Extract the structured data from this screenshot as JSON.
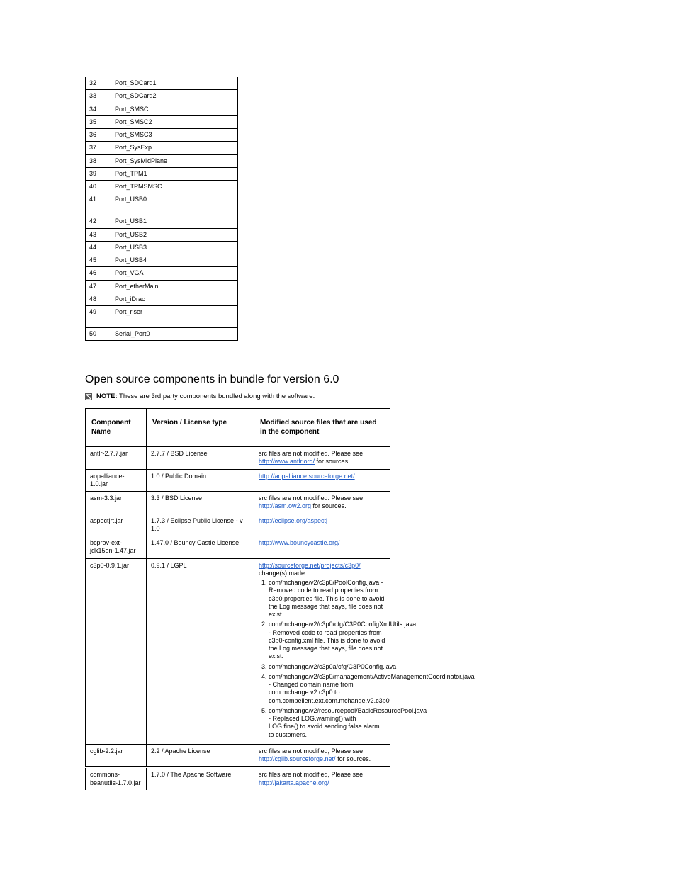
{
  "ports": [
    {
      "n": "32",
      "name": "Port_SDCard1"
    },
    {
      "n": "33",
      "name": "Port_SDCard2"
    },
    {
      "n": "34",
      "name": "Port_SMSC"
    },
    {
      "n": "35",
      "name": "Port_SMSC2"
    },
    {
      "n": "36",
      "name": "Port_SMSC3"
    },
    {
      "n": "37",
      "name": "Port_SysExp"
    },
    {
      "n": "38",
      "name": "Port_SysMidPlane"
    },
    {
      "n": "39",
      "name": "Port_TPM1"
    },
    {
      "n": "40",
      "name": "Port_TPMSMSC"
    },
    {
      "n": "41",
      "name": "Port_USB0"
    },
    {
      "n": "42",
      "name": "Port_USB1"
    },
    {
      "n": "43",
      "name": "Port_USB2"
    },
    {
      "n": "44",
      "name": "Port_USB3"
    },
    {
      "n": "45",
      "name": "Port_USB4"
    },
    {
      "n": "46",
      "name": "Port_VGA"
    },
    {
      "n": "47",
      "name": "Port_etherMain"
    },
    {
      "n": "48",
      "name": "Port_iDrac"
    },
    {
      "n": "49",
      "name": "Port_riser"
    },
    {
      "n": "50",
      "name": "Serial_Port0"
    }
  ],
  "section_heading": "Open source components in bundle for version 6.0",
  "note_label": "NOTE:",
  "note_text": "These are 3rd party components bundled along with the software.",
  "components_headers": {
    "name": "Component Name",
    "version": "Version / License type",
    "desc": "Modified source files that are used in the component"
  },
  "components": [
    {
      "name": "antlr-2.7.7.jar",
      "version": "2.7.7 / BSD License",
      "desc_pre": "src files are not modified. Please see ",
      "link": "http://www.antlr.org/",
      "desc_post": " for sources."
    },
    {
      "name": "aopalliance-1.0.jar",
      "version": "1.0 / Public Domain",
      "desc_pre": "",
      "link": "http://aopalliance.sourceforge.net/",
      "desc_post": ""
    },
    {
      "name": "asm-3.3.jar",
      "version": "3.3 / BSD License",
      "desc_pre": "src files are not modified. Please see ",
      "link": "http://asm.ow2.org",
      "desc_post": " for sources."
    },
    {
      "name": "aspectjrt.jar",
      "version": "1.7.3 / Eclipse Public License - v 1.0",
      "desc_pre": "",
      "link": "http://eclipse.org/aspectj",
      "desc_post": ""
    },
    {
      "name": "bcprov-ext-jdk15on-1.47.jar",
      "version": "1.47.0 / Bouncy Castle License",
      "desc_pre": "",
      "link": "http://www.bouncycastle.org/",
      "desc_post": ""
    },
    {
      "name": "c3p0-0.9.1.jar",
      "version": "0.9.1 / LGPL",
      "desc_pre": "",
      "link": "http://sourceforge.net/projects/c3p0/",
      "desc_post": "\nchange(s) made:",
      "changes": [
        "com/mchange/v2/c3p0/PoolConfig.java - Removed code to read properties from c3p0.properties file. This is done to avoid the Log message that says, file does not exist.",
        "com/mchange/v2/c3p0/cfg/C3P0ConfigXmlUtils.java - Removed code to read properties from c3p0-config.xml file. This is done to avoid the Log message that says, file does not exist.",
        "com/mchange/v2/c3p0a/cfg/C3P0Config.java",
        "com/mchange/v2/c3p0/management/ActiveManagementCoordinator.java - Changed domain name from com.mchange.v2.c3p0 to com.compellent.ext.com.mchange.v2.c3p0",
        "com/mchange/v2/resourcepool/BasicResourcePool.java - Replaced LOG.warning() with LOG.fine() to avoid sending false alarm to customers."
      ]
    },
    {
      "name": "cglib-2.2.jar",
      "version": "2.2 / Apache License",
      "desc_pre": "src files are not modified, Please see ",
      "link": "http://cglib.sourceforge.net/",
      "desc_post": " for sources."
    }
  ],
  "trademark": {
    "name": "commons-beanutils-1.7.0.jar",
    "version": "1.7.0 / The Apache Software",
    "desc_pre": "src files are not modified, Please see ",
    "link": "http://jakarta.apache.org/",
    "desc_post": ""
  }
}
